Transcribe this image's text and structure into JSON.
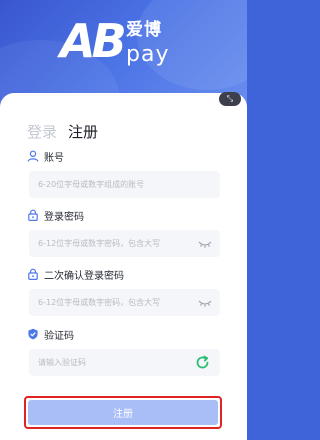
{
  "brand": {
    "logo_mark": "AB",
    "logo_cn": "爱博",
    "logo_pay": "pay"
  },
  "tabs": {
    "login_label": "登录",
    "register_label": "注册"
  },
  "form": {
    "account": {
      "label": "账号",
      "icon": "user-icon",
      "placeholder": "6-20位字母或数字组成的账号"
    },
    "password": {
      "label": "登录密码",
      "icon": "lock-icon",
      "placeholder": "6-12位字母或数字密码，包含大写"
    },
    "confirm_password": {
      "label": "二次确认登录密码",
      "icon": "lock-icon",
      "placeholder": "6-12位字母或数字密码，包含大写"
    },
    "captcha": {
      "label": "验证码",
      "icon": "shield-check-icon",
      "placeholder": "请输入验证码"
    }
  },
  "submit_label": "注册",
  "colors": {
    "brand_blue": "#3f63d8",
    "button_blue": "#a9bdf7",
    "captcha_green": "#2bbf73",
    "highlight_red": "#e02424"
  }
}
